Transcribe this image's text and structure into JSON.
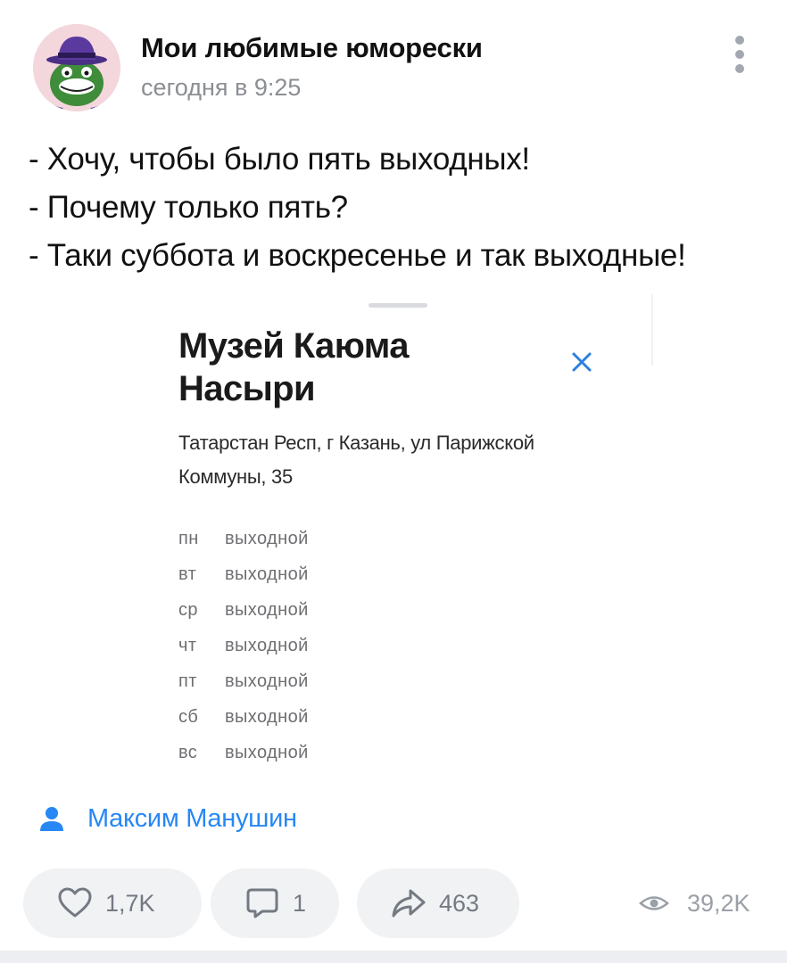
{
  "post": {
    "group_name": "Мои любимые юморески",
    "time": "сегодня в 9:25",
    "text_lines": [
      "- Хочу, чтобы было пять выходных!",
      "- Почему только пять?",
      "- Таки суббота и воскресенье и так выходные!"
    ]
  },
  "attachment": {
    "title": "Музей Каюма Насыри",
    "address": "Татарстан Респ, г Казань, ул Парижской Коммуны, 35",
    "schedule": [
      {
        "day": "пн",
        "status": "выходной"
      },
      {
        "day": "вт",
        "status": "выходной"
      },
      {
        "day": "ср",
        "status": "выходной"
      },
      {
        "day": "чт",
        "status": "выходной"
      },
      {
        "day": "пт",
        "status": "выходной"
      },
      {
        "day": "сб",
        "status": "выходной"
      },
      {
        "day": "вс",
        "status": "выходной"
      }
    ]
  },
  "author": {
    "name": "Максим Манушин"
  },
  "actions": {
    "likes": "1,7K",
    "comments": "1",
    "shares": "463",
    "views": "39,2K"
  },
  "colors": {
    "accent": "#2787f5",
    "muted": "#8b8e93",
    "pill_bg": "#f1f2f4",
    "close_icon": "#2d7fe0"
  },
  "icons": {
    "more": "more-vertical-icon",
    "close": "close-icon",
    "author": "user-icon",
    "like": "heart-icon",
    "comment": "comment-icon",
    "share": "share-arrow-icon",
    "views": "eye-icon"
  }
}
